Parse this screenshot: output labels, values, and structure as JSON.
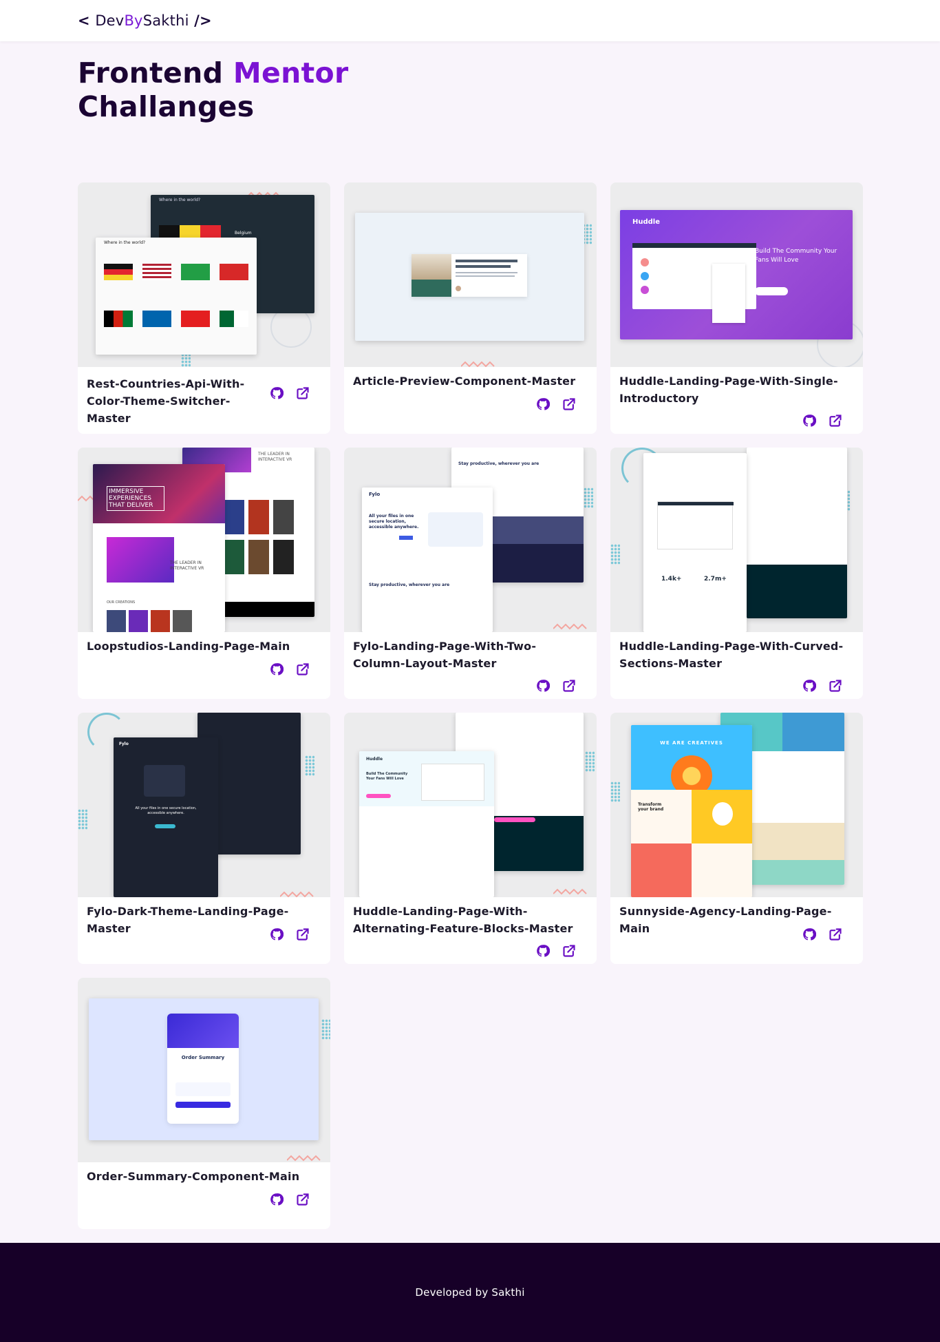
{
  "header": {
    "logo_open": "< ",
    "logo_dev": "Dev",
    "logo_by": "By",
    "logo_sakthi": "Sakthi",
    "logo_close": " />"
  },
  "page": {
    "title_part1": "Frontend ",
    "title_accent": "Mentor",
    "title_line2": "Challanges"
  },
  "projects": [
    {
      "name": "Rest-Countries-Api-With-Color-Theme-Switcher-Master"
    },
    {
      "name": "Article-Preview-Component-Master"
    },
    {
      "name": "Huddle-Landing-Page-With-Single-Introductory"
    },
    {
      "name": "Loopstudios-Landing-Page-Main"
    },
    {
      "name": "Fylo-Landing-Page-With-Two-Column-Layout-Master"
    },
    {
      "name": "Huddle-Landing-Page-With-Curved-Sections-Master"
    },
    {
      "name": "Fylo-Dark-Theme-Landing-Page-Master"
    },
    {
      "name": "Huddle-Landing-Page-With-Alternating-Feature-Blocks-Master"
    },
    {
      "name": "Sunnyside-Agency-Landing-Page-Main"
    },
    {
      "name": "Order-Summary-Component-Main"
    }
  ],
  "thumb_text": {
    "huddle_brand": "Huddle",
    "huddle_tagline": "Build The Community Your Fans Will Love",
    "loop_hero": "IMMERSIVE EXPERIENCES THAT DELIVER",
    "loop_leader": "THE LEADER IN INTERACTIVE VR",
    "loop_creations": "OUR CREATIONS",
    "fylo_brand": "Fylo",
    "fylo_headline": "All your files in one secure location, accessible anywhere.",
    "fylo_productive": "Stay productive, wherever you are",
    "huddle2_stat1": "1.4k+",
    "huddle2_stat2": "2.7m+",
    "sunny_headline": "WE ARE CREATIVES",
    "sunny_transform": "Transform your brand",
    "order_title": "Order Summary",
    "rest_where": "Where in the world?",
    "rest_belgium": "Belgium"
  },
  "icons": {
    "repo": "github-icon",
    "live": "external-link-icon"
  },
  "colors": {
    "accent": "#7b12d3",
    "heading": "#1b0433",
    "footer_bg": "#170028",
    "icon": "#6a0fc4",
    "page_bg": "#f9f4fb"
  },
  "footer": {
    "credit": "Developed by Sakthi"
  }
}
